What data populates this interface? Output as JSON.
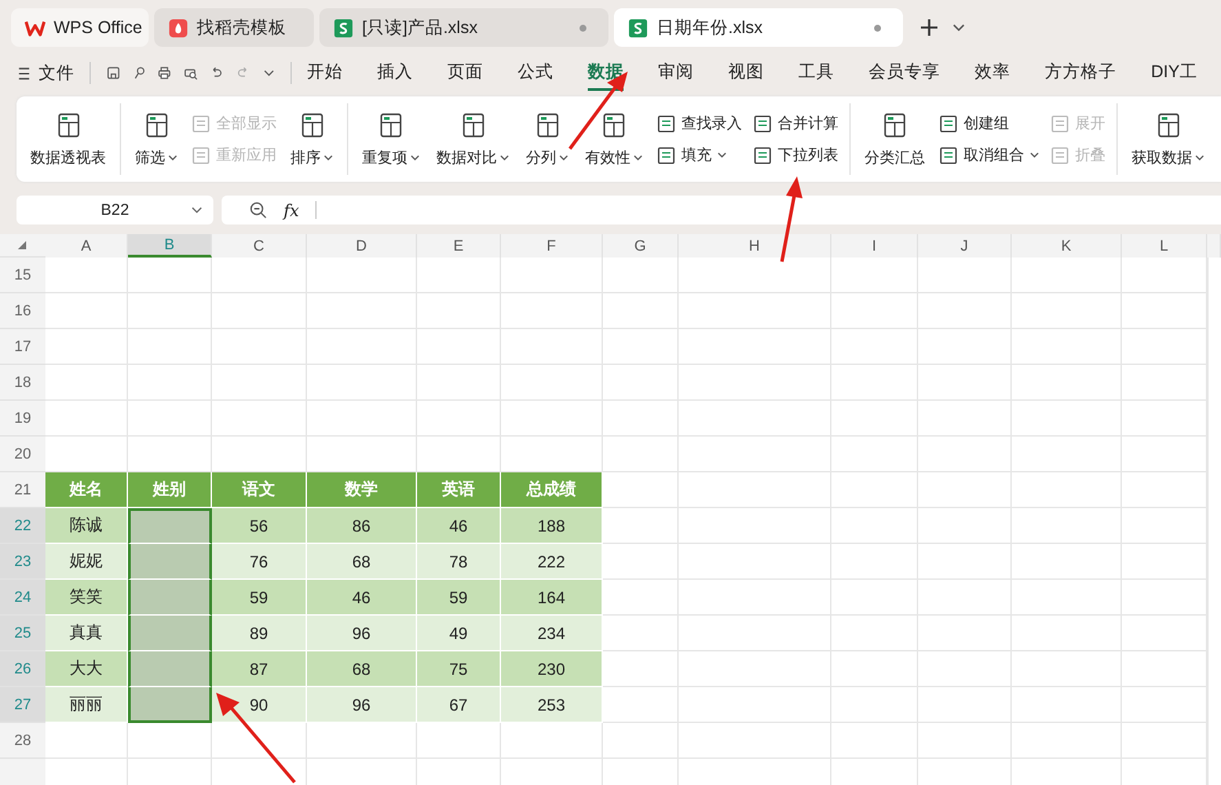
{
  "tabs": [
    {
      "label": "WPS Office",
      "kind": "home",
      "selected": false,
      "dot": false
    },
    {
      "label": "找稻壳模板",
      "kind": "template",
      "selected": false,
      "dot": false
    },
    {
      "label": "[只读]产品.xlsx",
      "kind": "sheet",
      "selected": false,
      "dot": true
    },
    {
      "label": "日期年份.xlsx",
      "kind": "sheet",
      "selected": true,
      "dot": true
    }
  ],
  "menu": {
    "file": "文件",
    "tabs": [
      {
        "label": "开始",
        "selected": false
      },
      {
        "label": "插入",
        "selected": false
      },
      {
        "label": "页面",
        "selected": false
      },
      {
        "label": "公式",
        "selected": false
      },
      {
        "label": "数据",
        "selected": true
      },
      {
        "label": "审阅",
        "selected": false
      },
      {
        "label": "视图",
        "selected": false
      },
      {
        "label": "工具",
        "selected": false
      },
      {
        "label": "会员专享",
        "selected": false
      },
      {
        "label": "效率",
        "selected": false
      },
      {
        "label": "方方格子",
        "selected": false
      },
      {
        "label": "DIY工",
        "selected": false
      }
    ]
  },
  "ribbon": [
    {
      "items": [
        {
          "kind": "big",
          "label": "数据透视表",
          "dropdown": false
        }
      ]
    },
    {
      "items": [
        {
          "kind": "big",
          "label": "筛选",
          "dropdown": true
        },
        {
          "kind": "stack",
          "entries": [
            {
              "label": "全部显示",
              "disabled": true,
              "dropdown": false
            },
            {
              "label": "重新应用",
              "disabled": true,
              "dropdown": false
            }
          ]
        },
        {
          "kind": "big",
          "label": "排序",
          "dropdown": true
        }
      ]
    },
    {
      "items": [
        {
          "kind": "big",
          "label": "重复项",
          "dropdown": true
        },
        {
          "kind": "big",
          "label": "数据对比",
          "dropdown": true
        },
        {
          "kind": "big",
          "label": "分列",
          "dropdown": true
        },
        {
          "kind": "big",
          "label": "有效性",
          "dropdown": true
        },
        {
          "kind": "stack",
          "entries": [
            {
              "label": "查找录入",
              "disabled": false,
              "dropdown": false
            },
            {
              "label": "填充",
              "disabled": false,
              "dropdown": true
            }
          ]
        },
        {
          "kind": "stack",
          "entries": [
            {
              "label": "合并计算",
              "disabled": false,
              "dropdown": false
            },
            {
              "label": "下拉列表",
              "disabled": false,
              "dropdown": false
            }
          ]
        }
      ]
    },
    {
      "items": [
        {
          "kind": "big",
          "label": "分类汇总",
          "dropdown": false
        },
        {
          "kind": "stack",
          "entries": [
            {
              "label": "创建组",
              "disabled": false,
              "dropdown": false
            },
            {
              "label": "取消组合",
              "disabled": false,
              "dropdown": true
            }
          ]
        },
        {
          "kind": "stack",
          "entries": [
            {
              "label": "展开",
              "disabled": true,
              "dropdown": false
            },
            {
              "label": "折叠",
              "disabled": true,
              "dropdown": false
            }
          ]
        }
      ]
    },
    {
      "items": [
        {
          "kind": "big",
          "label": "获取数据",
          "dropdown": true
        }
      ]
    }
  ],
  "name_box": "B22",
  "formula_label": "fx",
  "columns": [
    {
      "label": "A",
      "selected": false
    },
    {
      "label": "B",
      "selected": true
    },
    {
      "label": "C",
      "selected": false
    },
    {
      "label": "D",
      "selected": false
    },
    {
      "label": "E",
      "selected": false
    },
    {
      "label": "F",
      "selected": false
    },
    {
      "label": "G",
      "selected": false
    },
    {
      "label": "H",
      "selected": false
    },
    {
      "label": "I",
      "selected": false
    },
    {
      "label": "J",
      "selected": false
    },
    {
      "label": "K",
      "selected": false
    },
    {
      "label": "L",
      "selected": false
    }
  ],
  "rows": [
    {
      "label": "15",
      "kind": "blank",
      "selected": false,
      "cells": []
    },
    {
      "label": "16",
      "kind": "blank",
      "selected": false,
      "cells": []
    },
    {
      "label": "17",
      "kind": "blank",
      "selected": false,
      "cells": []
    },
    {
      "label": "18",
      "kind": "blank",
      "selected": false,
      "cells": []
    },
    {
      "label": "19",
      "kind": "blank",
      "selected": false,
      "cells": []
    },
    {
      "label": "20",
      "kind": "blank",
      "selected": false,
      "cells": []
    },
    {
      "label": "21",
      "kind": "header",
      "selected": false,
      "cells": [
        "姓名",
        "姓别",
        "语文",
        "数学",
        "英语",
        "总成绩"
      ]
    },
    {
      "label": "22",
      "kind": "data",
      "selected": true,
      "cells": [
        "陈诚",
        "",
        "56",
        "86",
        "46",
        "188"
      ]
    },
    {
      "label": "23",
      "kind": "data",
      "selected": true,
      "cells": [
        "妮妮",
        "",
        "76",
        "68",
        "78",
        "222"
      ]
    },
    {
      "label": "24",
      "kind": "data",
      "selected": true,
      "cells": [
        "笑笑",
        "",
        "59",
        "46",
        "59",
        "164"
      ]
    },
    {
      "label": "25",
      "kind": "data",
      "selected": true,
      "cells": [
        "真真",
        "",
        "89",
        "96",
        "49",
        "234"
      ]
    },
    {
      "label": "26",
      "kind": "data",
      "selected": true,
      "cells": [
        "大大",
        "",
        "87",
        "68",
        "75",
        "230"
      ]
    },
    {
      "label": "27",
      "kind": "data",
      "selected": true,
      "cells": [
        "丽丽",
        "",
        "90",
        "96",
        "67",
        "253"
      ]
    },
    {
      "label": "28",
      "kind": "blank",
      "selected": false,
      "cells": []
    }
  ]
}
